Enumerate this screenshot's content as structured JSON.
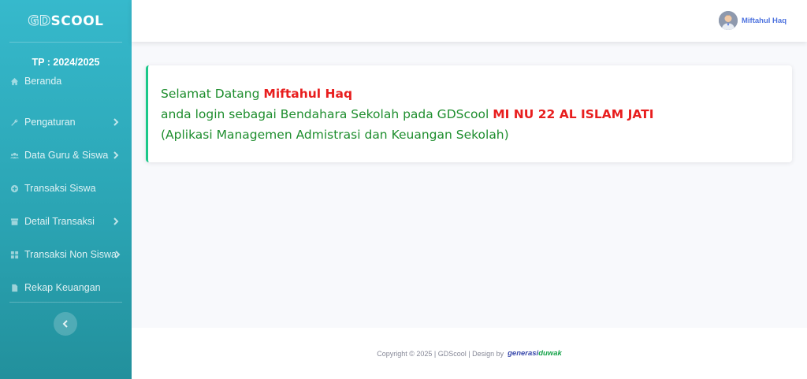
{
  "brand": {
    "logo_prefix": "GD",
    "logo_text": "SCOOL"
  },
  "sidebar": {
    "school_year": "TP : 2024/2025",
    "items": [
      {
        "label": "Beranda",
        "icon": "home-icon",
        "has_submenu": false
      },
      {
        "label": "Pengaturan",
        "icon": "wrench-icon",
        "has_submenu": true
      },
      {
        "label": "Data Guru & Siswa",
        "icon": "users-icon",
        "has_submenu": true
      },
      {
        "label": "Transaksi Siswa",
        "icon": "plus-circle-icon",
        "has_submenu": false
      },
      {
        "label": "Detail Transaksi",
        "icon": "archive-icon",
        "has_submenu": true
      },
      {
        "label": "Transaksi Non Siswa",
        "icon": "grid-icon",
        "has_submenu": true
      },
      {
        "label": "Rekap Keuangan",
        "icon": "file-icon",
        "has_submenu": false
      }
    ]
  },
  "topbar": {
    "user_name": "Miftahul Haq"
  },
  "welcome": {
    "greeting": "Selamat Datang",
    "user_name": "Miftahul Haq",
    "login_text": "anda login sebagai Bendahara Sekolah pada GDScool",
    "school_name": "MI NU 22 AL ISLAM JATI",
    "app_desc": "(Aplikasi Managemen Admistrasi dan Keuangan Sekolah)"
  },
  "footer": {
    "copyright": "Copyright © 2025 | GDScool | Design by",
    "brand_part1": "generasi",
    "brand_part2": "duwak"
  },
  "colors": {
    "sidebar": "#36b9cc",
    "accent_green": "#1cc88a",
    "text_green": "#1e8e2e",
    "text_red": "#e81e1e",
    "user_blue": "#4e73df"
  }
}
